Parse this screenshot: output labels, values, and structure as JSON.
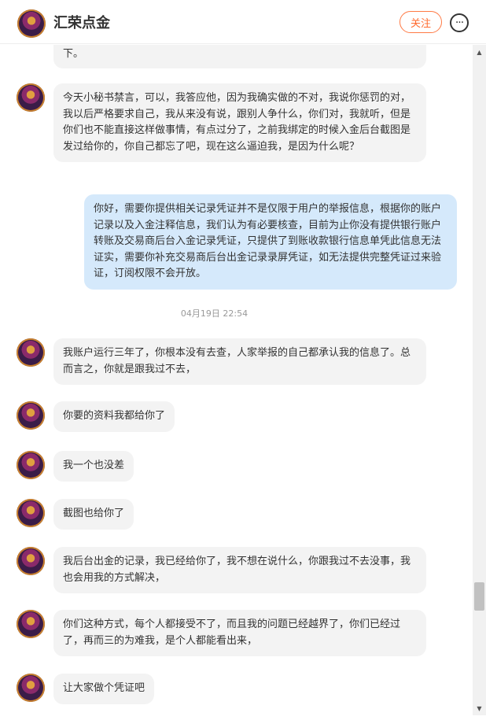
{
  "header": {
    "title": "汇荣点金",
    "follow_label": "关注",
    "more_icon": "ellipsis-icon"
  },
  "messages": [
    {
      "id": "m0",
      "from": "other",
      "text": "下。"
    },
    {
      "id": "m1",
      "from": "other",
      "text": "今天小秘书禁言，可以，我答应他，因为我确实做的不对，我说你惩罚的对，我以后严格要求自己，我从来没有说，跟别人争什么，你们对，我就听，但是你们也不能直接这样做事情，有点过分了，之前我绑定的时候入金后台截图是发过给你的，你自己都忘了吧，现在这么逼迫我，是因为什么呢？"
    },
    {
      "id": "m2",
      "from": "self",
      "text": "你好，需要你提供相关记录凭证并不是仅限于用户的举报信息，根据你的账户记录以及入金注释信息，我们认为有必要核查，目前为止你没有提供银行账户转账及交易商后台入金记录凭证，只提供了到账收款银行信息单凭此信息无法证实，需要你补充交易商后台出金记录录屏凭证，如无法提供完整凭证过来验证，订阅权限不会开放。"
    },
    {
      "id": "m3",
      "from": "other",
      "text": "我账户运行三年了，你根本没有去查，人家举报的自己都承认我的信息了。总而言之，你就是跟我过不去，"
    },
    {
      "id": "m4",
      "from": "other",
      "text": "你要的资料我都给你了"
    },
    {
      "id": "m5",
      "from": "other",
      "text": "我一个也没差"
    },
    {
      "id": "m6",
      "from": "other",
      "text": "截图也给你了"
    },
    {
      "id": "m7",
      "from": "other",
      "text": "我后台出金的记录，我已经给你了，我不想在说什么，你跟我过不去没事，我也会用我的方式解决，"
    },
    {
      "id": "m8",
      "from": "other",
      "text": "你们这种方式，每个人都接受不了，而且我的问题已经越界了，你们已经过了，再而三的为难我，是个人都能看出来，"
    },
    {
      "id": "m9",
      "from": "other",
      "text": "让大家做个凭证吧"
    }
  ],
  "timestamp": "04月19日 22:54",
  "scrollbar": {
    "up_icon": "scroll-up-arrow-icon",
    "down_icon": "scroll-down-arrow-icon",
    "position_fraction": 0.88
  }
}
